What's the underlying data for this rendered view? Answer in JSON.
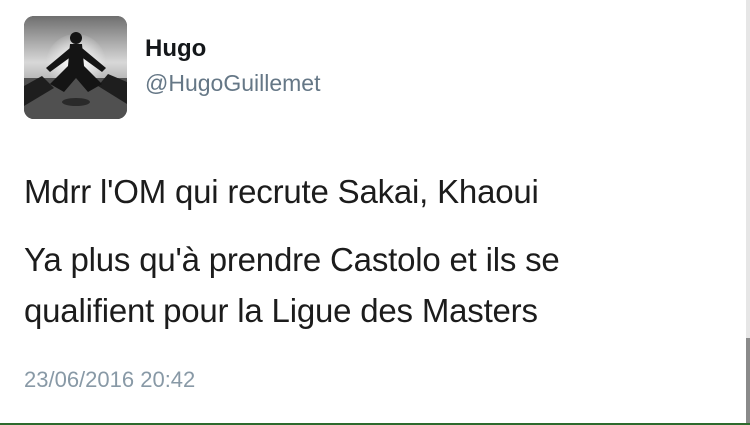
{
  "tweet": {
    "display_name": "Hugo",
    "handle": "@HugoGuillemet",
    "text_line_1": "Mdrr l'OM qui recrute Sakai, Khaoui",
    "text_line_2": "Ya plus qu'à prendre Castolo et ils se",
    "text_line_3": "qualifient pour la Ligue des Masters",
    "timestamp": "23/06/2016 20:42",
    "avatar_icon": "avatar-photo-person-meditating"
  },
  "colors": {
    "name": "#14171a",
    "handle": "#657786",
    "text": "#1c1c1c",
    "timestamp": "#8899a6",
    "background": "#ffffff"
  }
}
